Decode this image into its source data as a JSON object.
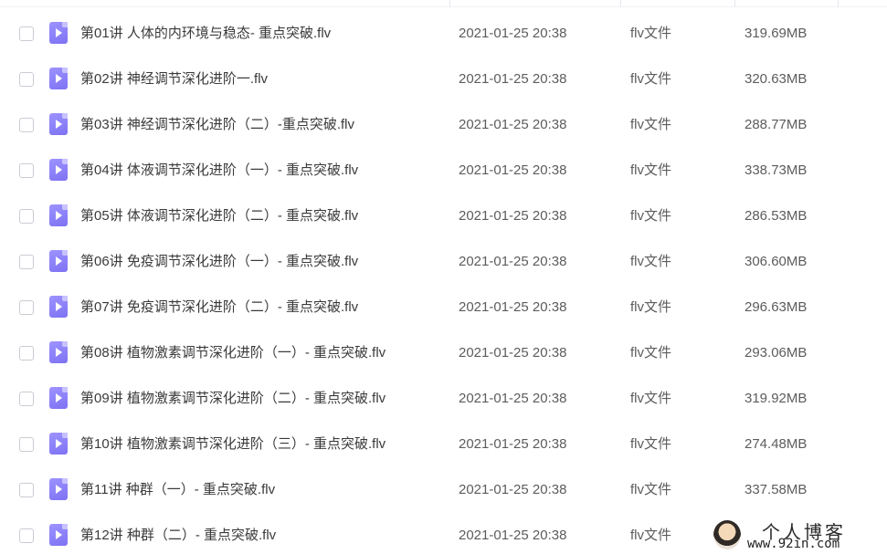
{
  "files": [
    {
      "name": "第01讲 人体的内环境与稳态- 重点突破.flv",
      "date": "2021-01-25 20:38",
      "type": "flv文件",
      "size": "319.69MB"
    },
    {
      "name": "第02讲 神经调节深化进阶一.flv",
      "date": "2021-01-25 20:38",
      "type": "flv文件",
      "size": "320.63MB"
    },
    {
      "name": "第03讲 神经调节深化进阶（二）-重点突破.flv",
      "date": "2021-01-25 20:38",
      "type": "flv文件",
      "size": "288.77MB"
    },
    {
      "name": "第04讲 体液调节深化进阶（一）- 重点突破.flv",
      "date": "2021-01-25 20:38",
      "type": "flv文件",
      "size": "338.73MB"
    },
    {
      "name": "第05讲 体液调节深化进阶（二）- 重点突破.flv",
      "date": "2021-01-25 20:38",
      "type": "flv文件",
      "size": "286.53MB"
    },
    {
      "name": "第06讲 免疫调节深化进阶（一）- 重点突破.flv",
      "date": "2021-01-25 20:38",
      "type": "flv文件",
      "size": "306.60MB"
    },
    {
      "name": "第07讲 免疫调节深化进阶（二）- 重点突破.flv",
      "date": "2021-01-25 20:38",
      "type": "flv文件",
      "size": "296.63MB"
    },
    {
      "name": "第08讲 植物激素调节深化进阶（一）- 重点突破.flv",
      "date": "2021-01-25 20:38",
      "type": "flv文件",
      "size": "293.06MB"
    },
    {
      "name": "第09讲 植物激素调节深化进阶（二）- 重点突破.flv",
      "date": "2021-01-25 20:38",
      "type": "flv文件",
      "size": "319.92MB"
    },
    {
      "name": "第10讲 植物激素调节深化进阶（三）- 重点突破.flv",
      "date": "2021-01-25 20:38",
      "type": "flv文件",
      "size": "274.48MB"
    },
    {
      "name": "第11讲 种群（一）- 重点突破.flv",
      "date": "2021-01-25 20:38",
      "type": "flv文件",
      "size": "337.58MB"
    },
    {
      "name": "第12讲 种群（二）- 重点突破.flv",
      "date": "2021-01-25 20:38",
      "type": "flv文件",
      "size": ""
    }
  ],
  "watermark": {
    "title": "个人博客",
    "url": "www.92in.com"
  },
  "colors": {
    "file_icon": "#8a80f7",
    "checkbox_border": "#c9ccd3",
    "text": "#3a3a3a"
  },
  "icons": {
    "row": "video-file-icon"
  }
}
